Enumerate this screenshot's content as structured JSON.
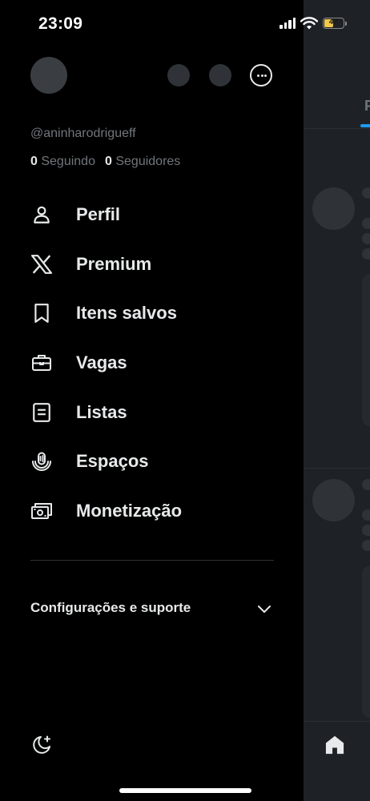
{
  "status_bar": {
    "time": "23:09",
    "battery_label": "47",
    "battery_level": 0.47,
    "battery_color": "#f2c84b",
    "icons": [
      "cellular-signal-icon",
      "wifi-icon",
      "battery-icon"
    ]
  },
  "drawer": {
    "handle": "@aninharodrigueff",
    "following_count": "0",
    "following_label": "Seguindo",
    "followers_count": "0",
    "followers_label": "Seguidores",
    "menu": [
      {
        "label": "Perfil",
        "icon": "person-icon"
      },
      {
        "label": "Premium",
        "icon": "x-logo-icon"
      },
      {
        "label": "Itens salvos",
        "icon": "bookmark-icon"
      },
      {
        "label": "Vagas",
        "icon": "briefcase-icon"
      },
      {
        "label": "Listas",
        "icon": "list-icon"
      },
      {
        "label": "Espaços",
        "icon": "spaces-microphone-icon"
      },
      {
        "label": "Monetização",
        "icon": "money-icon"
      }
    ],
    "settings_label": "Configurações e suporte",
    "bottom_icon": "moon-icon"
  },
  "background": {
    "tab_partial_text": "P",
    "accent_color": "#1d9bf0",
    "bottom_icon": "home-icon"
  }
}
